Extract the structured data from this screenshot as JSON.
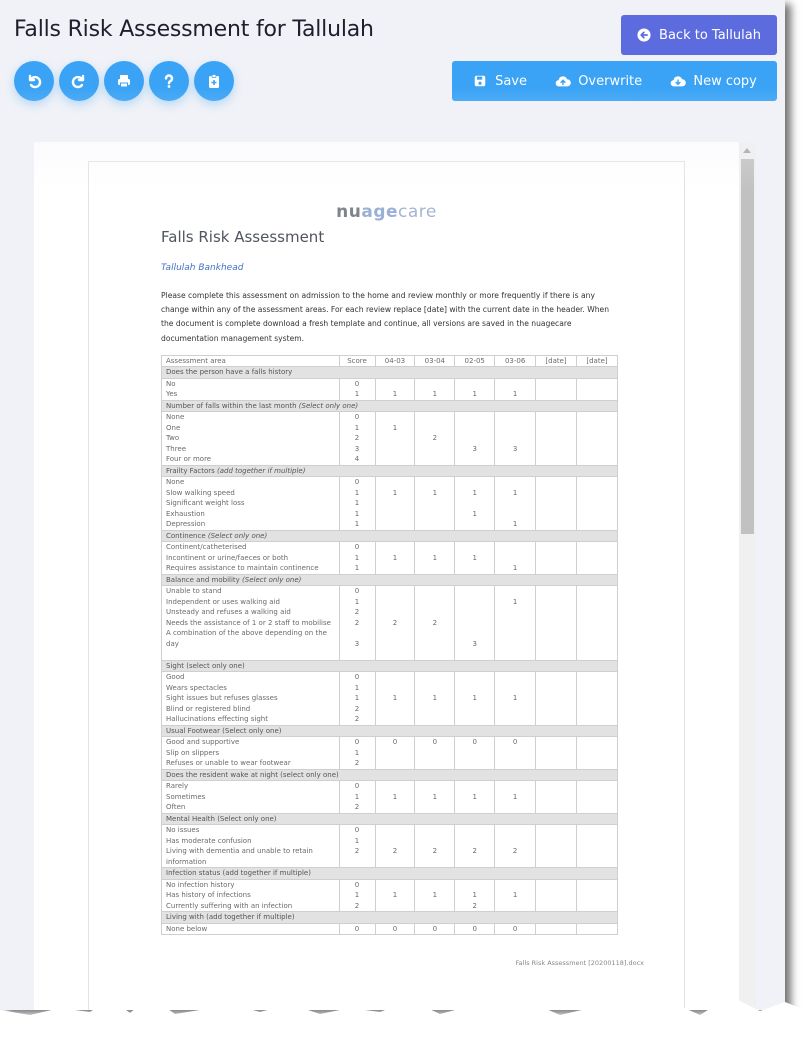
{
  "header": {
    "title": "Falls Risk Assessment for Tallulah",
    "back_button": "Back to Tallulah",
    "round_buttons": [
      {
        "name": "undo-button",
        "icon": "undo-icon"
      },
      {
        "name": "redo-button",
        "icon": "redo-icon"
      },
      {
        "name": "print-button",
        "icon": "print-icon"
      },
      {
        "name": "help-button",
        "icon": "question-icon"
      },
      {
        "name": "clipboard-add-button",
        "icon": "clipboard-plus-icon"
      }
    ],
    "actions": {
      "save": "Save",
      "overwrite": "Overwrite",
      "new_copy": "New copy"
    }
  },
  "colors": {
    "primary_blue": "#3aa3f5",
    "indigo": "#5c6bde",
    "background": "#f1f2f7"
  },
  "document": {
    "logo": {
      "part1": "nu",
      "part2": "age",
      "part3": "care"
    },
    "title": "Falls Risk Assessment",
    "resident_name": "Tallulah Bankhead",
    "instructions": "Please complete this assessment on admission to the home and review monthly or more frequently if there is any change within any of the assessment areas.  For each review replace [date] with the current date in the header.  When the document is complete download a fresh template and continue, all versions are saved in the nuagecare documentation management system.",
    "footer_filename": "Falls Risk Assessment [20200118].docx",
    "table": {
      "headers": [
        "Assessment area",
        "Score",
        "04-03",
        "03-04",
        "02-05",
        "03-06",
        "[date]",
        "[date]"
      ],
      "sections": [
        {
          "title": "Does the person have a falls history",
          "options": [
            {
              "label": "No",
              "score": "0",
              "values": [
                "",
                "",
                "",
                "",
                "",
                ""
              ]
            },
            {
              "label": "Yes",
              "score": "1",
              "values": [
                "1",
                "1",
                "1",
                "1",
                "",
                ""
              ]
            }
          ]
        },
        {
          "title": "Number of falls within the last month",
          "note": "(Select only one)",
          "options": [
            {
              "label": "None",
              "score": "0",
              "values": [
                "",
                "",
                "",
                "",
                "",
                ""
              ]
            },
            {
              "label": "One",
              "score": "1",
              "values": [
                "1",
                "",
                "",
                "",
                "",
                ""
              ]
            },
            {
              "label": "Two",
              "score": "2",
              "values": [
                "",
                "2",
                "",
                "",
                "",
                ""
              ]
            },
            {
              "label": "Three",
              "score": "3",
              "values": [
                "",
                "",
                "3",
                "3",
                "",
                ""
              ]
            },
            {
              "label": "Four or more",
              "score": "4",
              "values": [
                "",
                "",
                "",
                "",
                "",
                ""
              ]
            }
          ]
        },
        {
          "title": "Frailty Factors",
          "note": "(add together if multiple)",
          "options": [
            {
              "label": "None",
              "score": "0",
              "values": [
                "",
                "",
                "",
                "",
                "",
                ""
              ]
            },
            {
              "label": "Slow walking speed",
              "score": "1",
              "values": [
                "1",
                "1",
                "1",
                "1",
                "",
                ""
              ]
            },
            {
              "label": "Significant weight loss",
              "score": "1",
              "values": [
                "",
                "",
                "",
                "",
                "",
                ""
              ]
            },
            {
              "label": "Exhaustion",
              "score": "1",
              "values": [
                "",
                "",
                "1",
                "",
                "",
                ""
              ]
            },
            {
              "label": "Depression",
              "score": "1",
              "values": [
                "",
                "",
                "",
                "1",
                "",
                ""
              ]
            }
          ]
        },
        {
          "title": "Continence",
          "note": "(Select only one)",
          "options": [
            {
              "label": "Continent/catheterised",
              "score": "0",
              "values": [
                "",
                "",
                "",
                "",
                "",
                ""
              ]
            },
            {
              "label": "Incontinent or urine/faeces or both",
              "score": "1",
              "values": [
                "1",
                "1",
                "1",
                "",
                "",
                ""
              ]
            },
            {
              "label": "Requires assistance to maintain continence",
              "score": "1",
              "values": [
                "",
                "",
                "",
                "1",
                "",
                ""
              ]
            }
          ]
        },
        {
          "title": "Balance and mobility",
          "note": "(Select only one)",
          "options": [
            {
              "label": "Unable to stand",
              "score": "0",
              "values": [
                "",
                "",
                "",
                "",
                "",
                ""
              ]
            },
            {
              "label": "Independent or uses walking aid",
              "score": "1",
              "values": [
                "",
                "",
                "",
                "1",
                "",
                ""
              ]
            },
            {
              "label": "Unsteady and refuses a walking aid",
              "score": "2",
              "values": [
                "",
                "",
                "",
                "",
                "",
                ""
              ]
            },
            {
              "label": "Needs the assistance of 1 or 2 staff to mobilise",
              "score": "2",
              "values": [
                "2",
                "2",
                "",
                "",
                "",
                ""
              ]
            },
            {
              "label": "A combination of the above depending on the day",
              "score": "3",
              "values": [
                "",
                "",
                "3",
                "",
                "",
                ""
              ]
            }
          ]
        },
        {
          "title": "Sight (select only one)",
          "options": [
            {
              "label": "Good",
              "score": "0",
              "values": [
                "",
                "",
                "",
                "",
                "",
                ""
              ]
            },
            {
              "label": "Wears spectacles",
              "score": "1",
              "values": [
                "",
                "",
                "",
                "",
                "",
                ""
              ]
            },
            {
              "label": "Sight issues but refuses glasses",
              "score": "1",
              "values": [
                "1",
                "1",
                "1",
                "1",
                "",
                ""
              ]
            },
            {
              "label": "Blind or registered blind",
              "score": "2",
              "values": [
                "",
                "",
                "",
                "",
                "",
                ""
              ]
            },
            {
              "label": "Hallucinations effecting sight",
              "score": "2",
              "values": [
                "",
                "",
                "",
                "",
                "",
                ""
              ]
            }
          ]
        },
        {
          "title": "Usual Footwear (Select only one)",
          "options": [
            {
              "label": "Good and supportive",
              "score": "0",
              "values": [
                "0",
                "0",
                "0",
                "0",
                "",
                ""
              ]
            },
            {
              "label": "Slip on slippers",
              "score": "1",
              "values": [
                "",
                "",
                "",
                "",
                "",
                ""
              ]
            },
            {
              "label": "Refuses or unable to wear footwear",
              "score": "2",
              "values": [
                "",
                "",
                "",
                "",
                "",
                ""
              ]
            }
          ]
        },
        {
          "title": "Does the resident wake at night (select only one)",
          "options": [
            {
              "label": "Rarely",
              "score": "0",
              "values": [
                "",
                "",
                "",
                "",
                "",
                ""
              ]
            },
            {
              "label": "Sometimes",
              "score": "1",
              "values": [
                "1",
                "1",
                "1",
                "1",
                "",
                ""
              ]
            },
            {
              "label": "Often",
              "score": "2",
              "values": [
                "",
                "",
                "",
                "",
                "",
                ""
              ]
            }
          ]
        },
        {
          "title": "Mental Health (Select only one)",
          "options": [
            {
              "label": "No issues",
              "score": "0",
              "values": [
                "",
                "",
                "",
                "",
                "",
                ""
              ]
            },
            {
              "label": "Has moderate confusion",
              "score": "1",
              "values": [
                "",
                "",
                "",
                "",
                "",
                ""
              ]
            },
            {
              "label": "Living with dementia and unable to retain information",
              "score": "2",
              "values": [
                "2",
                "2",
                "2",
                "2",
                "",
                ""
              ]
            }
          ]
        },
        {
          "title": "Infection status (add together if multiple)",
          "options": [
            {
              "label": "No infection history",
              "score": "0",
              "values": [
                "",
                "",
                "",
                "",
                "",
                ""
              ]
            },
            {
              "label": "Has history of infections",
              "score": "1",
              "values": [
                "1",
                "1",
                "1",
                "1",
                "",
                ""
              ]
            },
            {
              "label": "Currently suffering with an infection",
              "score": "2",
              "values": [
                "",
                "",
                "2",
                "",
                "",
                ""
              ]
            }
          ]
        },
        {
          "title": "Living with (add together if multiple)",
          "options": [
            {
              "label": "None below",
              "score": "0",
              "values": [
                "0",
                "0",
                "0",
                "0",
                "",
                ""
              ]
            }
          ]
        }
      ]
    }
  }
}
